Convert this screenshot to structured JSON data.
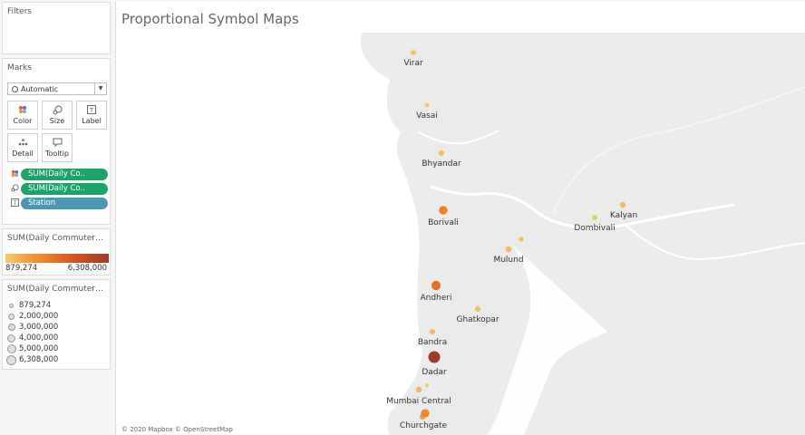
{
  "filters": {
    "title": "Filters"
  },
  "marks": {
    "title": "Marks",
    "mark_type": "Automatic",
    "cards": [
      {
        "label": "Color",
        "icon": "color-dots-icon"
      },
      {
        "label": "Size",
        "icon": "size-icon"
      },
      {
        "label": "Label",
        "icon": "label-icon"
      },
      {
        "label": "Detail",
        "icon": "detail-icon"
      },
      {
        "label": "Tooltip",
        "icon": "tooltip-icon"
      }
    ],
    "pills": [
      {
        "text": "SUM(Daily Co..",
        "kind": "color"
      },
      {
        "text": "SUM(Daily Co..",
        "kind": "size"
      },
      {
        "text": "Station",
        "kind": "label"
      }
    ]
  },
  "color_legend": {
    "title": "SUM(Daily Commuter C...",
    "min": "879,274",
    "max": "6,308,000"
  },
  "size_legend": {
    "title": "SUM(Daily Commuter C...",
    "items": [
      "879,274",
      "2,000,000",
      "3,000,000",
      "4,000,000",
      "5,000,000",
      "6,308,000"
    ]
  },
  "viz": {
    "title": "Proportional Symbol Maps",
    "attribution": "© 2020 Mapbox © OpenStreetMap",
    "stations": [
      {
        "name": "Virar",
        "value": 1100000
      },
      {
        "name": "Vasai",
        "value": 950000
      },
      {
        "name": "Bhyandar",
        "value": 1200000
      },
      {
        "name": "Borivali",
        "value": 3000000
      },
      {
        "name": "Kalyan",
        "value": 1300000
      },
      {
        "name": "Dombivali",
        "value": 1100000
      },
      {
        "name": "Mulund",
        "value": 1300000
      },
      {
        "name": "Andheri",
        "value": 3500000
      },
      {
        "name": "Ghatkopar",
        "value": 1200000
      },
      {
        "name": "Bandra",
        "value": 1200000
      },
      {
        "name": "Dadar",
        "value": 6308000
      },
      {
        "name": "Mumbai Central",
        "value": 1300000
      },
      {
        "name": "Churchgate",
        "value": 2800000
      }
    ]
  },
  "colors": {
    "color_min": "#f6c86a",
    "color_max": "#a13a2a",
    "land": "#ebebeb",
    "water": "#ffffff"
  }
}
